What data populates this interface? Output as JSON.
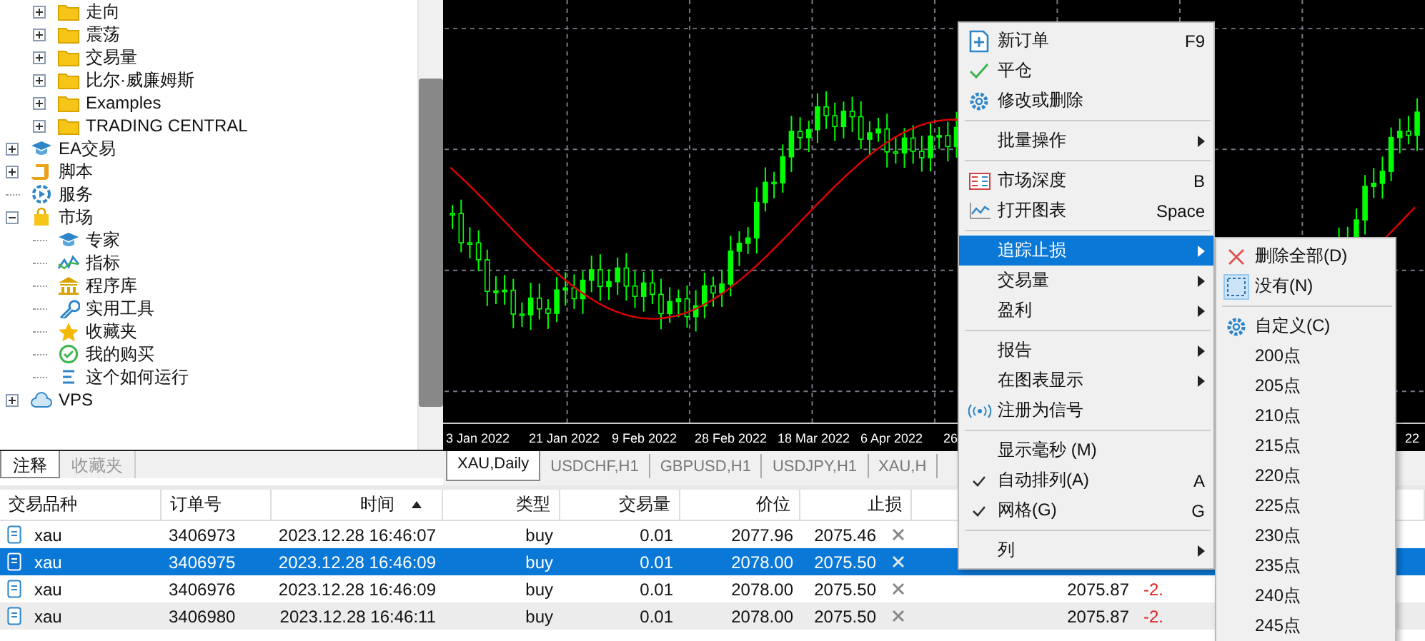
{
  "navigator": {
    "tree": [
      {
        "children": [
          {
            "label": "走向",
            "kind": "folder",
            "expanded": false
          },
          {
            "label": "震荡",
            "kind": "folder",
            "expanded": false
          },
          {
            "label": "交易量",
            "kind": "folder",
            "expanded": false
          },
          {
            "label": "比尔·威廉姆斯",
            "kind": "folder",
            "expanded": false
          },
          {
            "label": "Examples",
            "kind": "folder",
            "expanded": false
          },
          {
            "label": "TRADING CENTRAL",
            "kind": "folder",
            "expanded": false
          }
        ]
      },
      {
        "label": "EA交易",
        "kind": "cap",
        "expanded": false
      },
      {
        "label": "脚本",
        "kind": "scroll",
        "expanded": false
      },
      {
        "label": "服务",
        "kind": "service"
      },
      {
        "label": "市场",
        "kind": "bag",
        "expanded": true,
        "children": [
          {
            "label": "专家",
            "kind": "cap"
          },
          {
            "label": "指标",
            "kind": "indicator"
          },
          {
            "label": "程序库",
            "kind": "bank"
          },
          {
            "label": "实用工具",
            "kind": "wrench"
          },
          {
            "label": "收藏夹",
            "kind": "star"
          },
          {
            "label": "我的购买",
            "kind": "purchase"
          },
          {
            "label": "这个如何运行",
            "kind": "lines"
          }
        ]
      },
      {
        "label": "VPS",
        "kind": "cloud",
        "expanded": false
      }
    ],
    "tabs": [
      {
        "label": "注释",
        "selected": true
      },
      {
        "label": "收藏夹",
        "selected": false
      }
    ]
  },
  "chart": {
    "axis_labels": [
      "3 Jan 2022",
      "21 Jan 2022",
      "9 Feb 2022",
      "28 Feb 2022",
      "18 Mar 2022",
      "6 Apr 2022",
      "26",
      "22"
    ],
    "tabs": [
      {
        "label": "XAU,Daily",
        "selected": true
      },
      {
        "label": "USDCHF,H1",
        "selected": false
      },
      {
        "label": "GBPUSD,H1",
        "selected": false
      },
      {
        "label": "USDJPY,H1",
        "selected": false
      },
      {
        "label": "XAU,H",
        "selected": false
      }
    ]
  },
  "table": {
    "columns": [
      {
        "label": "交易品种",
        "sorted": false
      },
      {
        "label": "订单号",
        "sorted": false
      },
      {
        "label": "时间",
        "sorted": true
      },
      {
        "label": "类型",
        "sorted": false
      },
      {
        "label": "交易量",
        "sorted": false
      },
      {
        "label": "价位",
        "sorted": false
      },
      {
        "label": "止损",
        "sorted": false
      }
    ],
    "rows": [
      {
        "symbol": "xau",
        "order": "3406973",
        "time": "2023.12.28 16:46:07",
        "type": "buy",
        "volume": "0.01",
        "price": "2077.96",
        "stop_loss": "2075.46",
        "selected": false
      },
      {
        "symbol": "xau",
        "order": "3406975",
        "time": "2023.12.28 16:46:09",
        "type": "buy",
        "volume": "0.01",
        "price": "2078.00",
        "stop_loss": "2075.50",
        "selected": true
      },
      {
        "symbol": "xau",
        "order": "3406976",
        "time": "2023.12.28 16:46:09",
        "type": "buy",
        "volume": "0.01",
        "price": "2078.00",
        "stop_loss": "2075.50",
        "column_9": "2075.87",
        "column_10": "-2.",
        "selected": false
      },
      {
        "symbol": "xau",
        "order": "3406980",
        "time": "2023.12.28 16:46:11",
        "type": "buy",
        "volume": "0.01",
        "price": "2078.00",
        "stop_loss": "2075.50",
        "column_9": "2075.87",
        "column_10": "-2.",
        "selected": false
      }
    ]
  },
  "context_menu": {
    "sections": [
      [
        {
          "label": "新订单",
          "shortcut": "F9",
          "kind": "plus",
          "has_submenu": false,
          "checked": false,
          "selected": false
        },
        {
          "label": "平仓",
          "kind": "tick",
          "has_submenu": false,
          "checked": false,
          "selected": false
        },
        {
          "label": "修改或删除",
          "kind": "gear",
          "has_submenu": false,
          "checked": false,
          "selected": false
        }
      ],
      [
        {
          "label": "批量操作",
          "kind": "plain",
          "has_submenu": true,
          "checked": false,
          "selected": false
        }
      ],
      [
        {
          "label": "市场深度",
          "shortcut": "B",
          "kind": "depth",
          "has_submenu": false,
          "checked": false,
          "selected": false
        },
        {
          "label": "打开图表",
          "shortcut": "Space",
          "kind": "chart",
          "has_submenu": false,
          "checked": false,
          "selected": false
        }
      ],
      [
        {
          "label": "追踪止损",
          "kind": "plain",
          "has_submenu": true,
          "checked": false,
          "selected": true
        },
        {
          "label": "交易量",
          "kind": "plain",
          "has_submenu": true,
          "checked": false,
          "selected": false
        },
        {
          "label": "盈利",
          "kind": "plain",
          "has_submenu": true,
          "checked": false,
          "selected": false
        }
      ],
      [
        {
          "label": "报告",
          "kind": "plain",
          "has_submenu": true,
          "checked": false,
          "selected": false
        },
        {
          "label": "在图表显示",
          "kind": "plain",
          "has_submenu": true,
          "checked": false,
          "selected": false
        },
        {
          "label": "注册为信号",
          "kind": "signal",
          "has_submenu": false,
          "checked": false,
          "selected": false
        }
      ],
      [
        {
          "label": "显示毫秒 (M)",
          "kind": "plain",
          "has_submenu": false,
          "checked": false,
          "selected": false
        },
        {
          "label": "自动排列(A)",
          "shortcut": "A",
          "kind": "plain",
          "has_submenu": false,
          "checked": true,
          "selected": false
        },
        {
          "label": "网格(G)",
          "shortcut": "G",
          "kind": "plain",
          "has_submenu": false,
          "checked": true,
          "selected": false
        }
      ],
      [
        {
          "label": "列",
          "kind": "plain",
          "has_submenu": true,
          "checked": false,
          "selected": false
        }
      ]
    ]
  },
  "submenu": {
    "sections": [
      [
        {
          "label": "删除全部(D)",
          "kind": "cross",
          "checked": false
        },
        {
          "label": "没有(N)",
          "kind": "box",
          "checked": true
        }
      ],
      [
        {
          "label": "自定义(C)",
          "kind": "gear",
          "checked": false
        },
        {
          "label": "200点",
          "kind": "plain",
          "checked": false
        },
        {
          "label": "205点",
          "kind": "plain",
          "checked": false
        },
        {
          "label": "210点",
          "kind": "plain",
          "checked": false
        },
        {
          "label": "215点",
          "kind": "plain",
          "checked": false
        },
        {
          "label": "220点",
          "kind": "plain",
          "checked": false
        },
        {
          "label": "225点",
          "kind": "plain",
          "checked": false
        },
        {
          "label": "230点",
          "kind": "plain",
          "checked": false
        },
        {
          "label": "235点",
          "kind": "plain",
          "checked": false
        },
        {
          "label": "240点",
          "kind": "plain",
          "checked": false
        },
        {
          "label": "245点",
          "kind": "plain",
          "checked": false
        }
      ]
    ]
  }
}
